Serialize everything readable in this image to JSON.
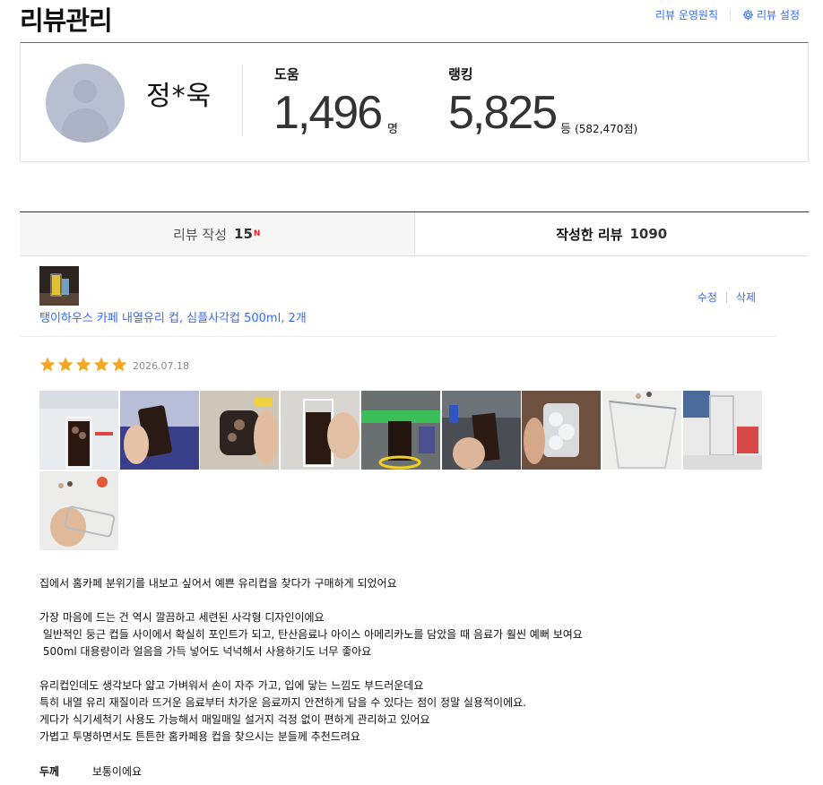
{
  "header": {
    "title": "리뷰관리",
    "links": {
      "policy": "리뷰 운영원칙",
      "settings": "리뷰 설정"
    }
  },
  "profile": {
    "name": "정*욱",
    "help_label": "도움",
    "help_value": "1,496",
    "help_unit": "명",
    "rank_label": "랭킹",
    "rank_value": "5,825",
    "rank_unit": "등",
    "rank_points": "(582,470점)"
  },
  "tabs": [
    {
      "label": "리뷰 작성",
      "count": "15",
      "badge": "N"
    },
    {
      "label": "작성한 리뷰",
      "count": "1090"
    }
  ],
  "review": {
    "product_name": "탱이하우스 카페 내열유리 컵, 심플사각컵 500ml, 2개",
    "edit_label": "수정",
    "delete_label": "삭제",
    "rating": 5,
    "date": "2026.07.18",
    "photo_count": 10,
    "paragraphs": [
      "집에서 홈카페 분위기를 내보고 싶어서 예쁜 유리컵을 찾다가 구매하게 되었어요",
      "",
      "가장 마음에 드는 건 역시 깔끔하고 세련된 사각형 디자인이에요",
      " 일반적인 둥근 컵들 사이에서 확실히 포인트가 되고, 탄산음료나 아이스 아메리카노를 담았을 때 음료가 훨씬 예뻐 보여요",
      " 500ml 대용량이라 얼음을 가득 넣어도 넉넉해서 사용하기도 너무 좋아요",
      "",
      "유리컵인데도 생각보다 얇고 가벼워서 손이 자주 가고, 입에 닿는 느낌도 부드러운데요",
      "특히 내열 유리 재질이라 뜨거운 음료부터 차가운 음료까지 안전하게 담을 수 있다는 점이 정말 실용적이에요.",
      "게다가 식기세척기 사용도 가능해서 매일매일 설거지 걱정 없이 편하게 관리하고 있어요",
      "가볍고 투명하면서도 튼튼한 홈카페용 컵을 찾으시는 분들께 추천드려요"
    ],
    "attributes": [
      {
        "key": "두께",
        "value": "보통이에요"
      }
    ]
  },
  "colors": {
    "accent": "#346aff",
    "star": "#f5a623",
    "badge": "#e52528"
  }
}
